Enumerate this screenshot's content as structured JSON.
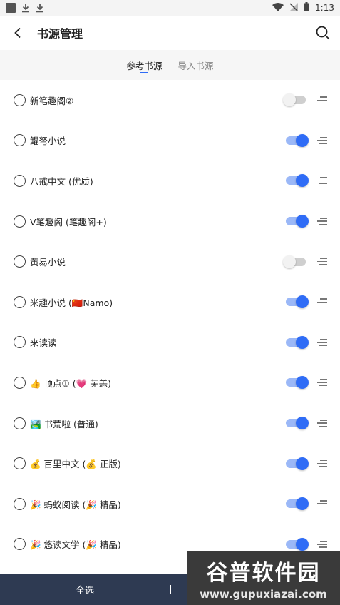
{
  "status_bar": {
    "time": "1:13",
    "icons": [
      "notification-icon",
      "download-icon",
      "download-icon",
      "wifi-icon",
      "no-signal-icon",
      "battery-icon"
    ]
  },
  "header": {
    "title": "书源管理",
    "back_icon": "back-arrow-icon",
    "search_icon": "search-icon"
  },
  "tabs": [
    {
      "label": "参考书源",
      "active": true
    },
    {
      "label": "导入书源",
      "active": false
    }
  ],
  "sources": [
    {
      "label": "新笔趣阁②",
      "enabled": false
    },
    {
      "label": "鲲弩小说",
      "enabled": true
    },
    {
      "label": "八戒中文 (优质)",
      "enabled": true
    },
    {
      "label": "V笔趣阁 (笔趣阁+)",
      "enabled": true
    },
    {
      "label": "黄易小说",
      "enabled": false
    },
    {
      "label": "米趣小说 (🇨🇳Namo)",
      "enabled": true
    },
    {
      "label": "来读读",
      "enabled": true
    },
    {
      "label": "👍 顶点① (💗 芜恙)",
      "enabled": true
    },
    {
      "label": "🏞️ 书荒啦 (普通)",
      "enabled": true
    },
    {
      "label": "💰 百里中文 (💰 正版)",
      "enabled": true
    },
    {
      "label": "🎉 蚂蚁阅读 (🎉 精品)",
      "enabled": true
    },
    {
      "label": "🎉 悠读文学 (🎉 精品)",
      "enabled": true
    }
  ],
  "bottom_bar": {
    "select_all_label": "全选",
    "divider_text": ""
  },
  "watermark": {
    "title": "谷普软件园",
    "url": "www.gupuxiazai.com"
  },
  "colors": {
    "accent": "#2f6cf6",
    "bottom_bar": "#2e3a52"
  }
}
